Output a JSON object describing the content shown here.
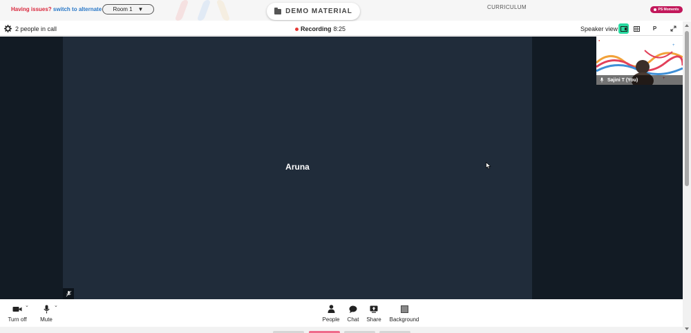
{
  "banner": {
    "issues_text": "Having issues?",
    "alt_room_link": "switch to alternate room",
    "room_selected": "Room 1",
    "demo_material_label": "DEMO MATERIAL",
    "curriculum_label": "CURRICULUM",
    "moments_badge": "PS Moments"
  },
  "call_header": {
    "people_count": "2 people in call",
    "recording_label": "Recording",
    "recording_time": "8:25",
    "view_mode": "Speaker view",
    "presenter_button": "P"
  },
  "stage": {
    "main_participant": "Aruna",
    "self_participant": "Sajini T (You)"
  },
  "toolbar": {
    "camera_label": "Turn off",
    "mic_label": "Mute",
    "people_label": "People",
    "chat_label": "Chat",
    "share_label": "Share",
    "background_label": "Background"
  },
  "colors": {
    "stage_bg": "#121b24",
    "tile_bg": "#202c3a",
    "view_active": "#28d9a0",
    "recording_dot": "#e53935",
    "badge": "#c2185b"
  }
}
